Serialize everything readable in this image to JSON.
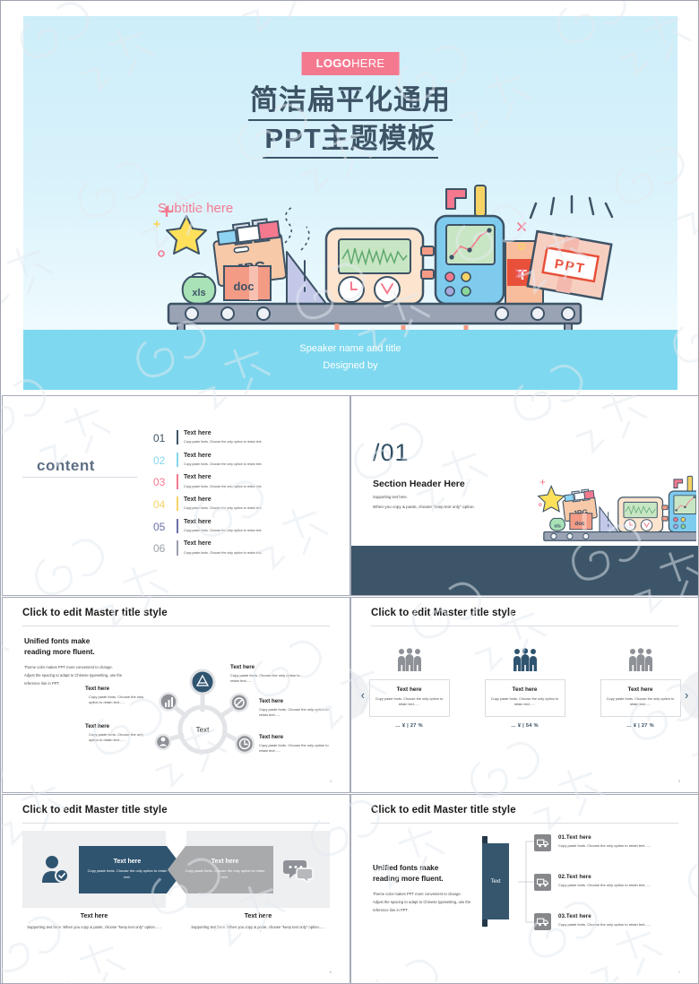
{
  "cover": {
    "logo_bold": "LOGO",
    "logo_light": "HERE",
    "title_line1": "简洁扁平化通用",
    "title_line2": "PPT主题模板",
    "subtitle": "Subtitle here",
    "speaker": "Speaker name and title",
    "designer": "Designed by",
    "illustration_labels": [
      "JPG",
      "xls",
      "doc",
      "T",
      "PPT"
    ],
    "band_color": "#7ED8EF",
    "title_color": "#3D5366",
    "accent_pink": "#F4798F"
  },
  "slides": {
    "toc": {
      "word": "content",
      "items": [
        {
          "num": "01",
          "title": "Text here",
          "desc": "Copy paste fonts. Choose the only option to retain text.",
          "color": "#3d5366"
        },
        {
          "num": "02",
          "title": "Text here",
          "desc": "Copy paste fonts. Choose the only option to retain text.",
          "color": "#86d7ef"
        },
        {
          "num": "03",
          "title": "Text here",
          "desc": "Copy paste fonts. Choose the only option to retain text.",
          "color": "#f4798f"
        },
        {
          "num": "04",
          "title": "Text here",
          "desc": "Copy paste fonts. Choose the only option to retain text.",
          "color": "#f6d365"
        },
        {
          "num": "05",
          "title": "Text here",
          "desc": "Copy paste fonts. Choose the only option to retain text.",
          "color": "#6a6fa8"
        },
        {
          "num": "06",
          "title": "Text here",
          "desc": "Copy paste fonts. Choose the only option to retain text.",
          "color": "#9aa0aa"
        }
      ]
    },
    "section": {
      "number": "/01",
      "header": "Section Header Here",
      "support_line1": "Supporting text here.",
      "support_line2": "When you copy & paste, choose \"keep text only\" option.",
      "footer_color": "#3C5568"
    },
    "diagram": {
      "title": "Click to edit Master title style",
      "lead_line1": "Unified fonts make",
      "lead_line2": "reading more fluent.",
      "body_line1": "Theme color makes PPT more convenient to change.",
      "body_line2": "Adjust the spacing to adapt to Chinese typesetting, use the",
      "body_line3": "reference line in PPT.",
      "center_label": "Text",
      "notes": [
        {
          "title": "Text here",
          "desc": "Copy paste fonts. Choose the only option to retain text......"
        },
        {
          "title": "Text here",
          "desc": "Copy paste fonts. Choose the only option to retain text......"
        },
        {
          "title": "Text here",
          "desc": "Copy paste fonts. Choose the only option to retain text......"
        },
        {
          "title": "Text here",
          "desc": "Copy paste fonts. Choose the only option to retain text......"
        },
        {
          "title": "Text here",
          "desc": "Copy paste fonts. Choose the only option to retain text......"
        }
      ],
      "page": "4"
    },
    "people": {
      "title": "Click to edit Master title style",
      "cards": [
        {
          "title": "Text here",
          "desc": "Copy paste fonts. Choose the only option to retain text......",
          "value": "… ¥ | 27 %",
          "highlight": false
        },
        {
          "title": "Text here",
          "desc": "Copy paste fonts. Choose the only option to retain text......",
          "value": "… ¥ | 54 %",
          "highlight": true
        },
        {
          "title": "Text here",
          "desc": "Copy paste fonts. Choose the only option to retain text......",
          "value": "… ¥ | 27 %",
          "highlight": false
        }
      ],
      "prev_arrow": "‹",
      "next_arrow": "›",
      "page": "5"
    },
    "arrows": {
      "title": "Click to edit Master title style",
      "left_arrow_title": "Text here",
      "left_arrow_desc": "Copy paste fonts. Choose the only option to retain text.",
      "right_arrow_title": "Text here",
      "right_arrow_desc": "Copy paste fonts. Choose the only option to retain text.",
      "left_caption_title": "Text here",
      "left_caption_desc": "Supporting text here. When you copy & paste, choose \"keep text only\" option......",
      "right_caption_title": "Text here",
      "right_caption_desc": "Supporting text here. When you copy & paste, choose \"keep text only\" option......",
      "page": "6"
    },
    "flagtree": {
      "title": "Click to edit Master title style",
      "lead_line1": "Unified fonts make",
      "lead_line2": "reading more fluent.",
      "body_line1": "Theme color makes PPT more convenient to change.",
      "body_line2": "Adjust the spacing to adapt to Chinese typesetting, use the",
      "body_line3": "reference line in PPT.",
      "flag_label": "Text",
      "items": [
        {
          "title": "01.Text here",
          "desc": "Copy paste fonts. Choose the only option to retain text......"
        },
        {
          "title": "02.Text here",
          "desc": "Copy paste fonts. Choose the only option to retain text......"
        },
        {
          "title": "03.Text here",
          "desc": "Copy paste fonts. Choose the only option to retain text......"
        }
      ],
      "page": "7"
    }
  }
}
